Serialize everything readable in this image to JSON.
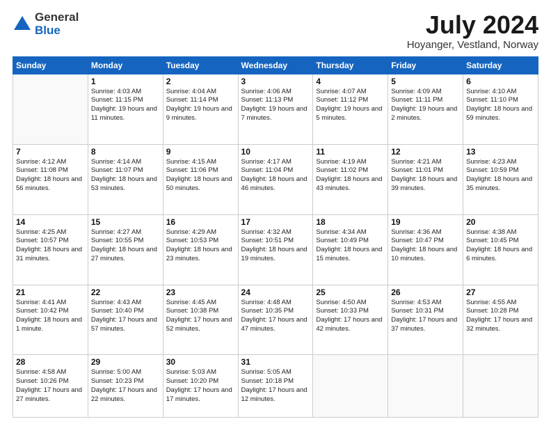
{
  "logo": {
    "general": "General",
    "blue": "Blue"
  },
  "header": {
    "title": "July 2024",
    "subtitle": "Hoyanger, Vestland, Norway"
  },
  "weekdays": [
    "Sunday",
    "Monday",
    "Tuesday",
    "Wednesday",
    "Thursday",
    "Friday",
    "Saturday"
  ],
  "weeks": [
    [
      {
        "day": "",
        "info": ""
      },
      {
        "day": "1",
        "info": "Sunrise: 4:03 AM\nSunset: 11:15 PM\nDaylight: 19 hours\nand 11 minutes."
      },
      {
        "day": "2",
        "info": "Sunrise: 4:04 AM\nSunset: 11:14 PM\nDaylight: 19 hours\nand 9 minutes."
      },
      {
        "day": "3",
        "info": "Sunrise: 4:06 AM\nSunset: 11:13 PM\nDaylight: 19 hours\nand 7 minutes."
      },
      {
        "day": "4",
        "info": "Sunrise: 4:07 AM\nSunset: 11:12 PM\nDaylight: 19 hours\nand 5 minutes."
      },
      {
        "day": "5",
        "info": "Sunrise: 4:09 AM\nSunset: 11:11 PM\nDaylight: 19 hours\nand 2 minutes."
      },
      {
        "day": "6",
        "info": "Sunrise: 4:10 AM\nSunset: 11:10 PM\nDaylight: 18 hours\nand 59 minutes."
      }
    ],
    [
      {
        "day": "7",
        "info": "Sunrise: 4:12 AM\nSunset: 11:08 PM\nDaylight: 18 hours\nand 56 minutes."
      },
      {
        "day": "8",
        "info": "Sunrise: 4:14 AM\nSunset: 11:07 PM\nDaylight: 18 hours\nand 53 minutes."
      },
      {
        "day": "9",
        "info": "Sunrise: 4:15 AM\nSunset: 11:06 PM\nDaylight: 18 hours\nand 50 minutes."
      },
      {
        "day": "10",
        "info": "Sunrise: 4:17 AM\nSunset: 11:04 PM\nDaylight: 18 hours\nand 46 minutes."
      },
      {
        "day": "11",
        "info": "Sunrise: 4:19 AM\nSunset: 11:02 PM\nDaylight: 18 hours\nand 43 minutes."
      },
      {
        "day": "12",
        "info": "Sunrise: 4:21 AM\nSunset: 11:01 PM\nDaylight: 18 hours\nand 39 minutes."
      },
      {
        "day": "13",
        "info": "Sunrise: 4:23 AM\nSunset: 10:59 PM\nDaylight: 18 hours\nand 35 minutes."
      }
    ],
    [
      {
        "day": "14",
        "info": "Sunrise: 4:25 AM\nSunset: 10:57 PM\nDaylight: 18 hours\nand 31 minutes."
      },
      {
        "day": "15",
        "info": "Sunrise: 4:27 AM\nSunset: 10:55 PM\nDaylight: 18 hours\nand 27 minutes."
      },
      {
        "day": "16",
        "info": "Sunrise: 4:29 AM\nSunset: 10:53 PM\nDaylight: 18 hours\nand 23 minutes."
      },
      {
        "day": "17",
        "info": "Sunrise: 4:32 AM\nSunset: 10:51 PM\nDaylight: 18 hours\nand 19 minutes."
      },
      {
        "day": "18",
        "info": "Sunrise: 4:34 AM\nSunset: 10:49 PM\nDaylight: 18 hours\nand 15 minutes."
      },
      {
        "day": "19",
        "info": "Sunrise: 4:36 AM\nSunset: 10:47 PM\nDaylight: 18 hours\nand 10 minutes."
      },
      {
        "day": "20",
        "info": "Sunrise: 4:38 AM\nSunset: 10:45 PM\nDaylight: 18 hours\nand 6 minutes."
      }
    ],
    [
      {
        "day": "21",
        "info": "Sunrise: 4:41 AM\nSunset: 10:42 PM\nDaylight: 18 hours\nand 1 minute."
      },
      {
        "day": "22",
        "info": "Sunrise: 4:43 AM\nSunset: 10:40 PM\nDaylight: 17 hours\nand 57 minutes."
      },
      {
        "day": "23",
        "info": "Sunrise: 4:45 AM\nSunset: 10:38 PM\nDaylight: 17 hours\nand 52 minutes."
      },
      {
        "day": "24",
        "info": "Sunrise: 4:48 AM\nSunset: 10:35 PM\nDaylight: 17 hours\nand 47 minutes."
      },
      {
        "day": "25",
        "info": "Sunrise: 4:50 AM\nSunset: 10:33 PM\nDaylight: 17 hours\nand 42 minutes."
      },
      {
        "day": "26",
        "info": "Sunrise: 4:53 AM\nSunset: 10:31 PM\nDaylight: 17 hours\nand 37 minutes."
      },
      {
        "day": "27",
        "info": "Sunrise: 4:55 AM\nSunset: 10:28 PM\nDaylight: 17 hours\nand 32 minutes."
      }
    ],
    [
      {
        "day": "28",
        "info": "Sunrise: 4:58 AM\nSunset: 10:26 PM\nDaylight: 17 hours\nand 27 minutes."
      },
      {
        "day": "29",
        "info": "Sunrise: 5:00 AM\nSunset: 10:23 PM\nDaylight: 17 hours\nand 22 minutes."
      },
      {
        "day": "30",
        "info": "Sunrise: 5:03 AM\nSunset: 10:20 PM\nDaylight: 17 hours\nand 17 minutes."
      },
      {
        "day": "31",
        "info": "Sunrise: 5:05 AM\nSunset: 10:18 PM\nDaylight: 17 hours\nand 12 minutes."
      },
      {
        "day": "",
        "info": ""
      },
      {
        "day": "",
        "info": ""
      },
      {
        "day": "",
        "info": ""
      }
    ]
  ]
}
